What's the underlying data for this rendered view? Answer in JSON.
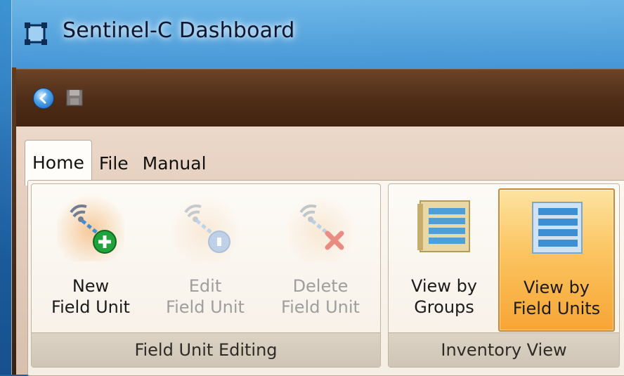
{
  "window": {
    "title": "Sentinel-C Dashboard",
    "icon": "app-frame-icon"
  },
  "quick_access": [
    {
      "name": "back-icon"
    },
    {
      "name": "save-icon"
    }
  ],
  "tabs": [
    {
      "label": "Home",
      "active": true
    },
    {
      "label": "File",
      "active": false
    },
    {
      "label": "Manual",
      "active": false
    }
  ],
  "groups": {
    "field_unit_editing": {
      "title": "Field Unit Editing",
      "buttons": [
        {
          "line1": "New",
          "line2": "Field Unit",
          "icon": "wireless-add-icon",
          "enabled": true
        },
        {
          "line1": "Edit",
          "line2": "Field Unit",
          "icon": "wireless-edit-icon",
          "enabled": false
        },
        {
          "line1": "Delete",
          "line2": "Field Unit",
          "icon": "wireless-delete-icon",
          "enabled": false
        }
      ]
    },
    "inventory_view": {
      "title": "Inventory View",
      "buttons": [
        {
          "line1": "View by",
          "line2": "Groups",
          "icon": "list-groups-icon",
          "selected": false
        },
        {
          "line1": "View by",
          "line2": "Field Units",
          "icon": "list-units-icon",
          "selected": true
        }
      ]
    }
  },
  "colors": {
    "accent_selected": "#f7a534",
    "quickbar": "#4e2c17",
    "add_green": "#1fa33a",
    "delete_red": "#e0453a"
  }
}
